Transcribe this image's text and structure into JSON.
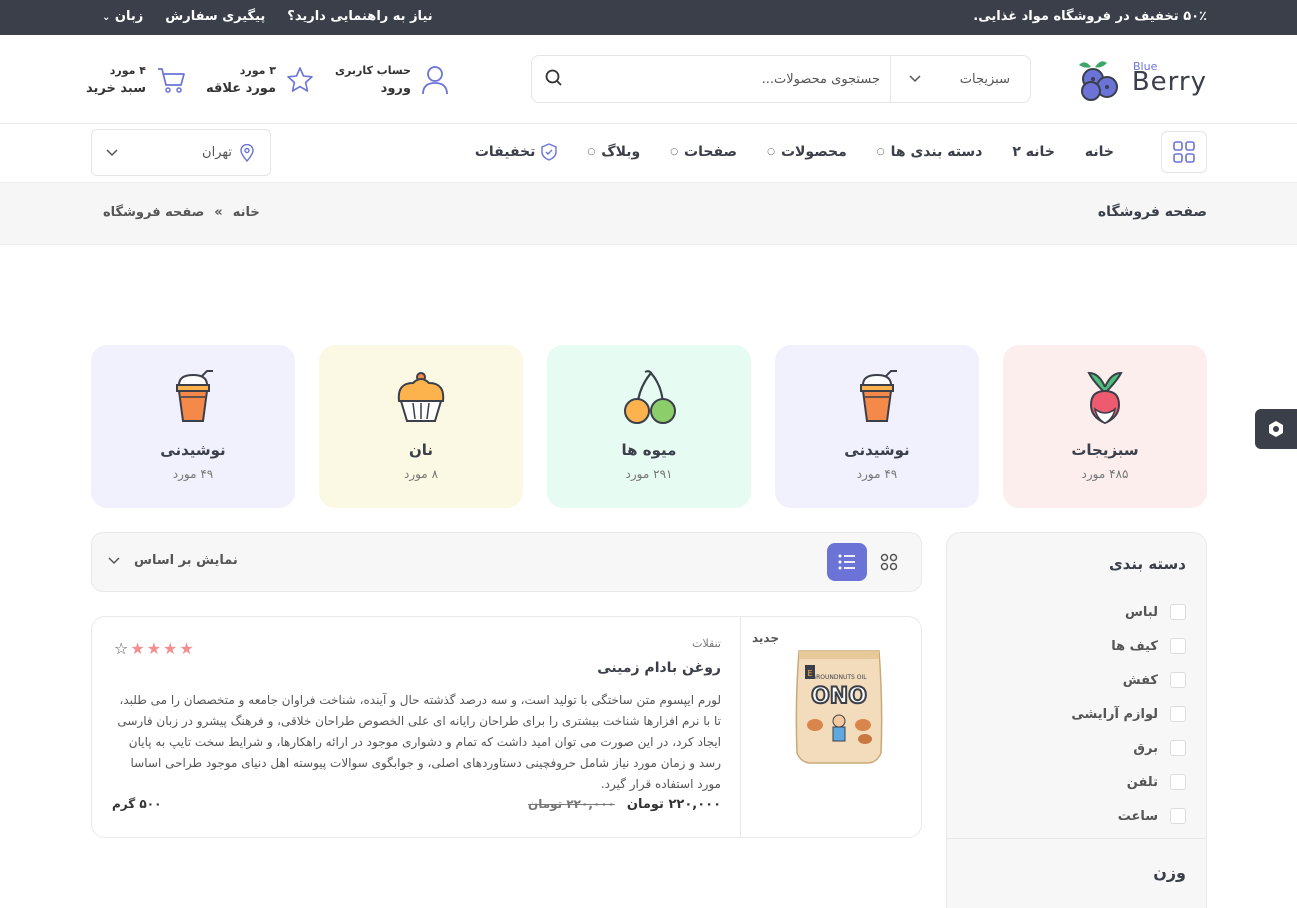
{
  "topbar": {
    "promo": "۵۰٪ تخفیف در فروشگاه مواد غذایی.",
    "help": "نیاز به راهنمایی دارید؟",
    "track": "پیگیری سفارش",
    "language": "زبان"
  },
  "header": {
    "logo_main": "Berry",
    "logo_small": "Blue",
    "search": {
      "category": "سبزیجات",
      "placeholder": "جستجوی محصولات..."
    },
    "account": {
      "line1": "حساب کاربری",
      "line2": "ورود"
    },
    "wishlist": {
      "line1": "۳ مورد",
      "line2": "مورد علاقه"
    },
    "cart": {
      "line1": "۴ مورد",
      "line2": "سبد خرید"
    }
  },
  "nav": {
    "items": [
      "خانه",
      "خانه ۲",
      "دسته بندی ها",
      "محصولات",
      "صفحات",
      "وبلاگ",
      "تخفیفات"
    ],
    "location": "تهران"
  },
  "breadcrumb": {
    "title": "صفحه فروشگاه",
    "home": "خانه",
    "separator": "»",
    "current": "صفحه فروشگاه"
  },
  "categories": [
    {
      "name": "سبزیجات",
      "count": "۴۸۵ مورد",
      "bg": "#fdeeee",
      "icon": "radish-icon"
    },
    {
      "name": "نوشیدنی",
      "count": "۴۹ مورد",
      "bg": "#f1f0fd",
      "icon": "drink-icon"
    },
    {
      "name": "میوه ها",
      "count": "۲۹۱ مورد",
      "bg": "#e6fbf1",
      "icon": "cherry-icon"
    },
    {
      "name": "نان",
      "count": "۸ مورد",
      "bg": "#fbf8e3",
      "icon": "cupcake-icon"
    },
    {
      "name": "نوشیدنی",
      "count": "۴۹ مورد",
      "bg": "#f1f0fd",
      "icon": "drink-icon"
    }
  ],
  "sidebar": {
    "heading": "دسته بندی",
    "items": [
      "لباس",
      "کیف ها",
      "کفش",
      "لوازم آرایشی",
      "برق",
      "تلفن",
      "ساعت"
    ],
    "heading2": "وزن"
  },
  "toolbar": {
    "sort_label": "نمایش بر اساس"
  },
  "product": {
    "badge": "جدید",
    "type": "تنقلات",
    "name": "روغن بادام زمینی",
    "description": "لورم ایپسوم متن ساختگی با تولید است، و سه درصد گذشته حال و آینده، شناخت فراوان جامعه و متخصصان را می طلبد، تا با نرم افزارها شناخت بیشتری را برای طراحان رایانه ای علی الخصوص طراحان خلاقی، و فرهنگ پیشرو در زبان فارسی ایجاد کرد، در این صورت می توان امید داشت که تمام و دشواری موجود در ارائه راهکارها، و شرایط سخت تایپ به پایان رسد و زمان مورد نیاز شامل حروفچینی دستاوردهای اصلی، و جوابگوی سوالات پیوسته اهل دنیای موجود طراحی اساسا مورد استفاده قرار گیرد.",
    "price": "۲۲۰,۰۰۰ تومان",
    "old_price": "۲۲۰,۰۰۰ تومان",
    "weight": "۵۰۰ گرم",
    "rating": 4,
    "pack_brand": "ONO",
    "pack_text": "GROUNDNUTS OIL"
  },
  "colors": {
    "accent": "#6b74d6",
    "dark": "#3a3f4a",
    "star": "#f28f8f"
  }
}
